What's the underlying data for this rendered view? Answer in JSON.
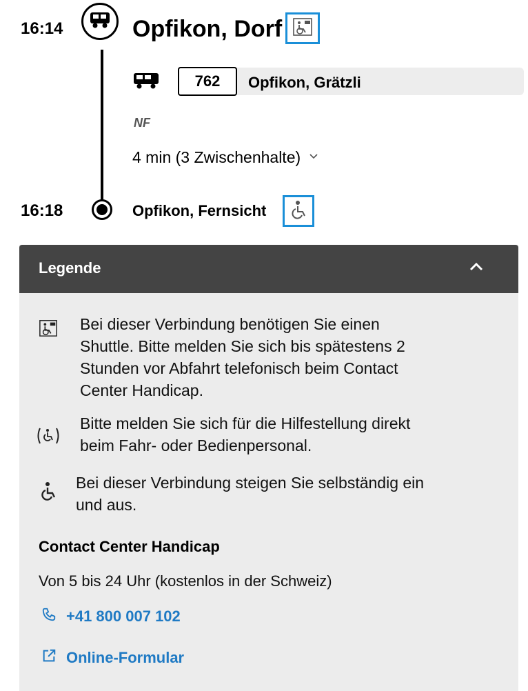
{
  "connection": {
    "departure": {
      "time": "16:14",
      "stop": "Opfikon, Dorf",
      "accessibility_icon": "shuttle-wheelchair-icon"
    },
    "leg": {
      "mode_icon": "bus-icon",
      "line": "762",
      "direction": "Opfikon, Grätzli",
      "attribute": "NF",
      "duration_text": "4 min (3 Zwischenhalte)"
    },
    "arrival": {
      "time": "16:18",
      "stop": "Opfikon, Fernsicht",
      "accessibility_icon": "wheelchair-icon"
    }
  },
  "legend": {
    "title": "Legende",
    "items": [
      {
        "icon": "shuttle-wheelchair-icon",
        "lines": [
          "Bei dieser Verbindung benötigen Sie einen",
          "Shuttle. Bitte melden Sie sich bis spätestens 2",
          "Stunden vor Abfahrt telefonisch beim Contact",
          "Center Handicap."
        ]
      },
      {
        "icon": "assisted-wheelchair-icon",
        "lines": [
          "Bitte melden Sie sich für die Hilfestellung direkt",
          "beim Fahr- oder Bedienpersonal."
        ]
      },
      {
        "icon": "wheelchair-icon",
        "lines": [
          "Bei dieser Verbindung steigen Sie selbständig ein",
          "und aus."
        ]
      }
    ],
    "contact_heading": "Contact Center Handicap",
    "hours": "Von 5 bis 24 Uhr (kostenlos in der Schweiz)",
    "phone": "+41 800 007 102",
    "form_link": "Online-Formular"
  },
  "colors": {
    "link": "#1f7ac4",
    "highlight_border": "#1a8fd8",
    "legend_header": "#444444",
    "legend_bg": "#ececec"
  }
}
